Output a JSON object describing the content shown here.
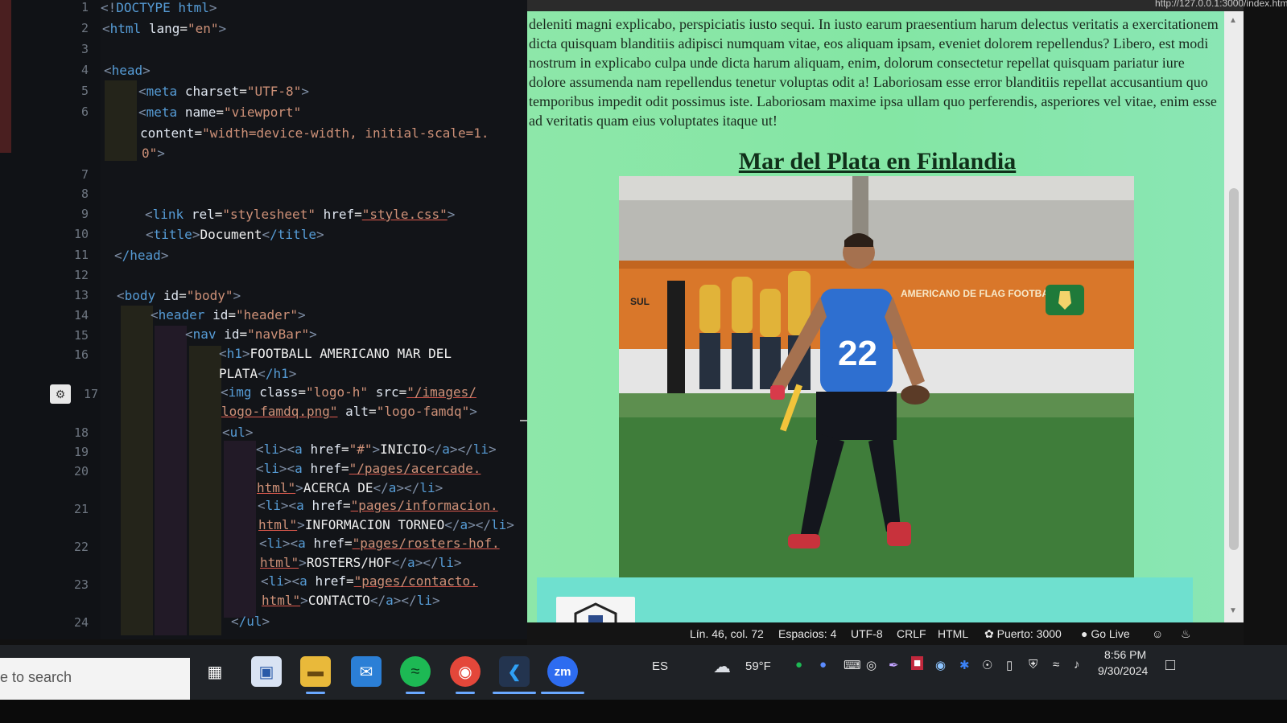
{
  "editor": {
    "line_numbers": [
      "1",
      "2",
      "3",
      "4",
      "5",
      "6",
      "7",
      "8",
      "9",
      "10",
      "11",
      "12",
      "13",
      "14",
      "15",
      "16",
      "17",
      "18",
      "19",
      "20",
      "21",
      "22",
      "23",
      "24"
    ],
    "lines": {
      "l1": "DOCTYPE html",
      "l2a": "html",
      "l2b": "lang",
      "l2c": "\"en\"",
      "l4": "head",
      "l5a": "meta",
      "l5b": "charset",
      "l5c": "\"UTF-8\"",
      "l6a": "meta",
      "l6b": "name",
      "l6c": "\"viewport\"",
      "l6d": "content",
      "l6e": "\"width=device-width, initial-scale=1.",
      "l6f": "0\"",
      "l9a": "link",
      "l9b": "rel",
      "l9c": "\"stylesheet\"",
      "l9d": "href",
      "l9e": "\"style.css\"",
      "l10a": "title",
      "l10b": "Document",
      "l10c": "/title",
      "l11": "/head",
      "l13a": "body",
      "l13b": "id",
      "l13c": "\"body\"",
      "l14a": "header",
      "l14b": "id",
      "l14c": "\"header\"",
      "l15a": "nav",
      "l15b": "id",
      "l15c": "\"navBar\"",
      "l16a": "h1",
      "l16b": "FOOTBALL AMERICANO MAR DEL",
      "l16c": "PLATA",
      "l16d": "/h1",
      "l17a": "img",
      "l17b": "class",
      "l17c": "\"logo-h\"",
      "l17d": "src",
      "l17e": "\"/images/",
      "l17f": "logo-famdq.png\"",
      "l17g": "alt",
      "l17h": "\"logo-famdq\"",
      "l18": "ul",
      "l19a": "\"#\"",
      "l19b": "INICIO",
      "l20a": "\"/pages/acercade.",
      "l20b": "html\"",
      "l20c": "ACERCA DE",
      "l21a": "\"pages/informacion.",
      "l21b": "html\"",
      "l21c": "INFORMACION TORNEO",
      "l22a": "\"pages/rosters-hof.",
      "l22b": "html\"",
      "l22c": "ROSTERS/HOF",
      "l23a": "\"pages/contacto.",
      "l23b": "html\"",
      "l23c": "CONTACTO",
      "l24": "/ul"
    }
  },
  "preview": {
    "url_fragment": "http://127.0.0.1:3000/index.html",
    "paragraph": "deleniti magni explicabo, perspiciatis iusto sequi. In iusto earum praesentium harum delectus veritatis a exercitationem dicta quisquam blanditiis adipisci numquam vitae, eos aliquam ipsam, eveniet dolorem repellendus? Libero, est modi nostrum in explicabo culpa unde dicta harum aliquam, enim, dolorum consectetur repellat quisquam pariatur iure dolore assumenda nam repellendus tenetur voluptas odit a! Laboriosam esse error blanditiis repellat accusantium quo temporibus impedit odit possimus iste. Laboriosam maxime ipsa ullam quo perferendis, asperiores vel vitae, enim esse ad veritatis quam eius voluptates itaque ut!",
    "section_title": "Mar del Plata en Finlandia",
    "banner_text": "AMERICANO DE FLAG FOOTBALL",
    "banner_left": "SUL",
    "jersey_number": "22"
  },
  "statusbar": {
    "position": "Lín. 46, col. 72",
    "spaces": "Espacios: 4",
    "encoding": "UTF-8",
    "eol": "CRLF",
    "language": "HTML",
    "port": "Puerto: 3000",
    "golive": "Go Live"
  },
  "taskbar": {
    "search_placeholder": "e to search",
    "language": "ES",
    "weather": "59°F",
    "time": "8:56 PM",
    "date": "9/30/2024",
    "zoom_label": "zm"
  },
  "colors": {
    "preview_bg": "#8de7a9",
    "footer_band": "#6fe0cf",
    "editor_bg": "#121418"
  }
}
